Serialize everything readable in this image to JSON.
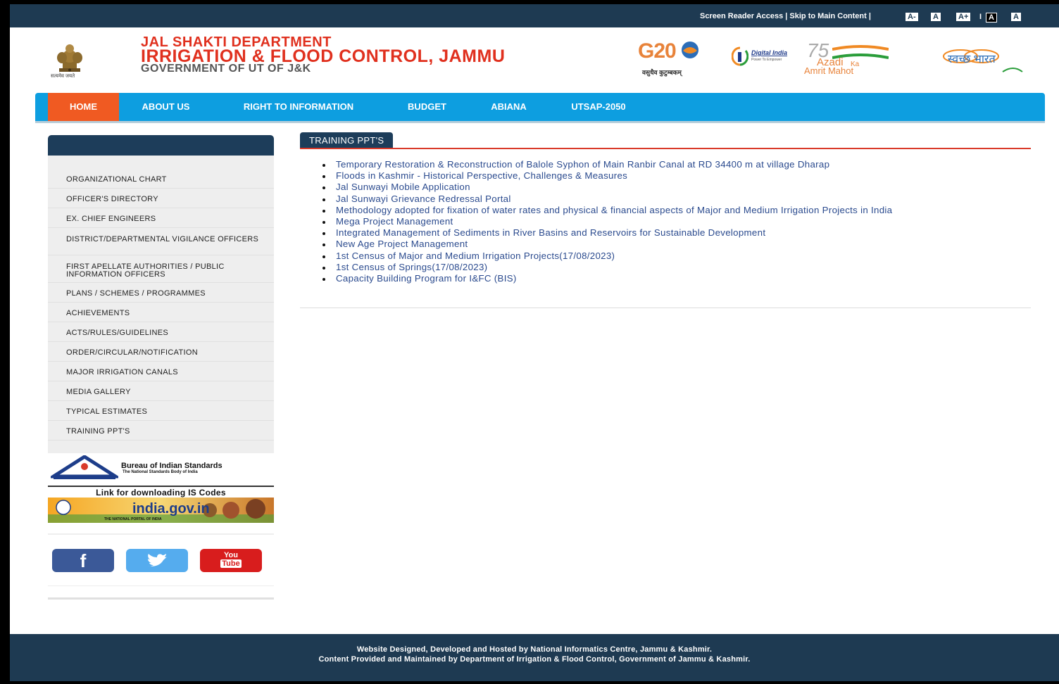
{
  "topbar": {
    "links": "Screen Reader Access | Skip to Main Content |",
    "font_buttons": [
      "A-",
      "A",
      "A+",
      "I",
      "A",
      "A"
    ]
  },
  "header": {
    "emblem_caption": "सत्यमेव जयते",
    "line1": "JAL SHAKTI DEPARTMENT",
    "line2": "IRRIGATION & FLOOD CONTROL, JAMMU",
    "line3": "GOVERNMENT OF UT OF J&K",
    "logos": {
      "g20": "G20",
      "g20_caption": "वसुधैव कुटुम्बकम्",
      "digital_india": "Digital India",
      "digital_india_caption": "Power To Empower",
      "azadi_num": "75",
      "azadi_l1": "Azadi",
      "azadi_ka": "Ka",
      "azadi_l2": "Amrit Mahot",
      "swachh": "स्वच्छ भारत"
    }
  },
  "nav": {
    "items": [
      "HOME",
      "ABOUT US",
      "RIGHT TO INFORMATION",
      "BUDGET",
      "ABIANA",
      "UTSAP-2050"
    ]
  },
  "sidebar": {
    "items": [
      "ORGANIZATIONAL CHART",
      "OFFICER'S DIRECTORY",
      "EX. CHIEF ENGINEERS",
      "DISTRICT/DEPARTMENTAL VIGILANCE OFFICERS",
      "FIRST APELLATE AUTHORITIES / PUBLIC INFORMATION OFFICERS",
      "PLANS / SCHEMES / PROGRAMMES",
      "ACHIEVEMENTS",
      "ACTS/RULES/GUIDELINES",
      "ORDER/CIRCULAR/NOTIFICATION",
      "MAJOR IRRIGATION CANALS",
      "MEDIA GALLERY",
      "TYPICAL ESTIMATES",
      "TRAINING PPT'S"
    ],
    "bis_title": "Bureau of Indian Standards",
    "bis_sub": "The National Standards Body of India",
    "bis_link": "Link for downloading IS Codes",
    "india_gov": "india.gov.in",
    "india_gov_sub": "THE NATIONAL PORTAL OF INDIA",
    "social": {
      "facebook": "f",
      "youtube_1": "You",
      "youtube_2": "Tube"
    }
  },
  "content": {
    "title": "TRAINING PPT'S",
    "items": [
      "Temporary Restoration & Reconstruction of Balole Syphon of Main Ranbir Canal at RD 34400 m at village Dharap",
      "Floods in Kashmir - Historical Perspective, Challenges & Measures",
      "Jal Sunwayi Mobile Application",
      "Jal Sunwayi Grievance Redressal Portal",
      "Methodology adopted for fixation of water rates and physical & financial aspects of Major and Medium Irrigation Projects in India",
      "Mega Project Management",
      "Integrated Management of Sediments in River Basins and Reservoirs for Sustainable Development",
      "New Age Project Management",
      "1st Census of Major and Medium Irrigation Projects(17/08/2023)",
      "1st Census of Springs(17/08/2023)",
      "Capacity Building Program for I&FC (BIS)"
    ]
  },
  "footer": {
    "line1": "Website Designed, Developed and Hosted by National Informatics Centre, Jammu & Kashmir.",
    "line2": "Content Provided and Maintained by Department of Irrigation & Flood Control, Government of Jammu & Kashmir."
  },
  "colors": {
    "header_bar": "#1e3a52",
    "nav_blue": "#0d9ee0",
    "nav_active": "#f05a22",
    "title_red": "#e0301e",
    "link_blue": "#2a4a8e"
  }
}
